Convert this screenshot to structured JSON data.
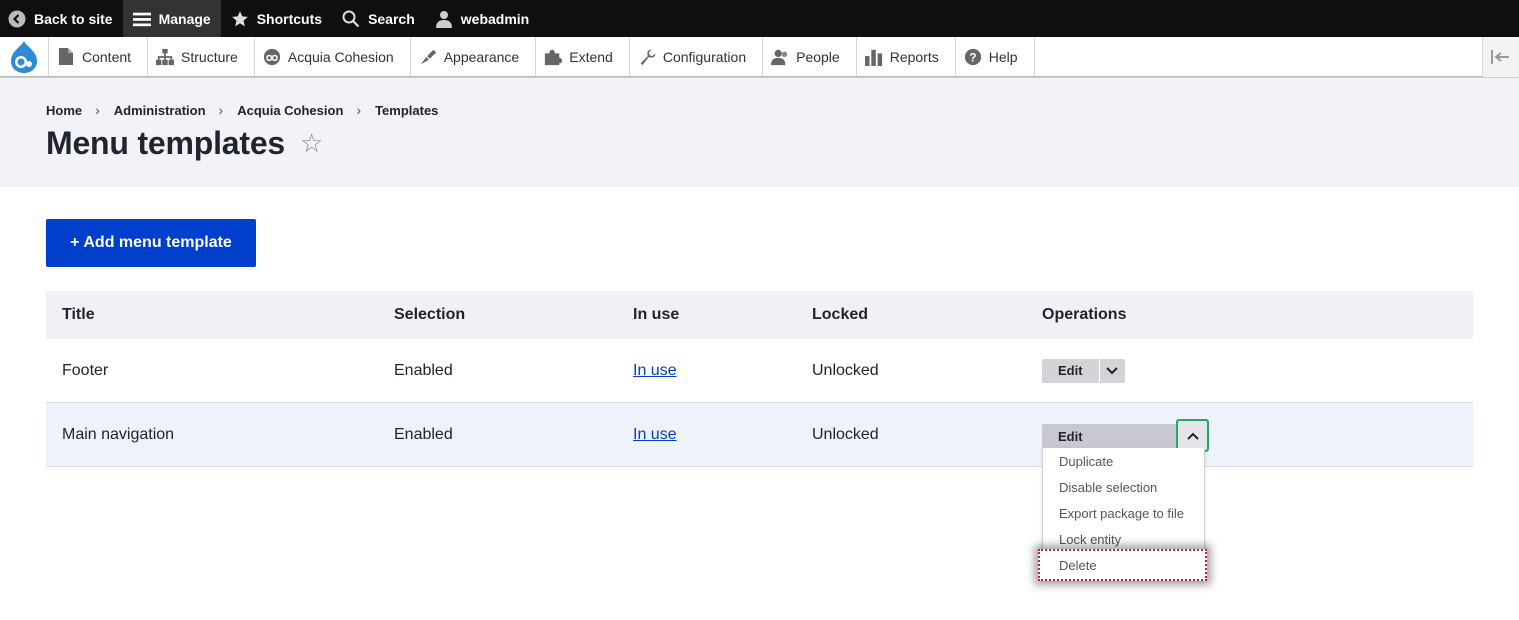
{
  "toolbar": {
    "back_to_site": "Back to site",
    "manage": "Manage",
    "shortcuts": "Shortcuts",
    "search": "Search",
    "user": "webadmin"
  },
  "tray": {
    "items": [
      {
        "label": "Content",
        "icon": "page-icon"
      },
      {
        "label": "Structure",
        "icon": "sitemap-icon"
      },
      {
        "label": "Acquia Cohesion",
        "icon": "cohesion-icon"
      },
      {
        "label": "Appearance",
        "icon": "paintbrush-icon"
      },
      {
        "label": "Extend",
        "icon": "puzzle-icon"
      },
      {
        "label": "Configuration",
        "icon": "wrench-icon"
      },
      {
        "label": "People",
        "icon": "people-icon"
      },
      {
        "label": "Reports",
        "icon": "bar-chart-icon"
      },
      {
        "label": "Help",
        "icon": "help-icon"
      }
    ]
  },
  "breadcrumb": [
    "Home",
    "Administration",
    "Acquia Cohesion",
    "Templates"
  ],
  "page_title": "Menu templates",
  "add_button": "+ Add menu template",
  "table": {
    "headers": [
      "Title",
      "Selection",
      "In use",
      "Locked",
      "Operations"
    ],
    "rows": [
      {
        "title": "Footer",
        "selection": "Enabled",
        "in_use": "In use",
        "locked": "Unlocked",
        "op": "Edit"
      },
      {
        "title": "Main navigation",
        "selection": "Enabled",
        "in_use": "In use",
        "locked": "Unlocked",
        "op": "Edit"
      }
    ]
  },
  "dropdown_menu": [
    "Duplicate",
    "Disable selection",
    "Export package to file",
    "Lock entity",
    "Delete"
  ],
  "colors": {
    "primary": "#003ecc",
    "focus_ring": "#26a769",
    "delete_focus": "#c2185b"
  }
}
